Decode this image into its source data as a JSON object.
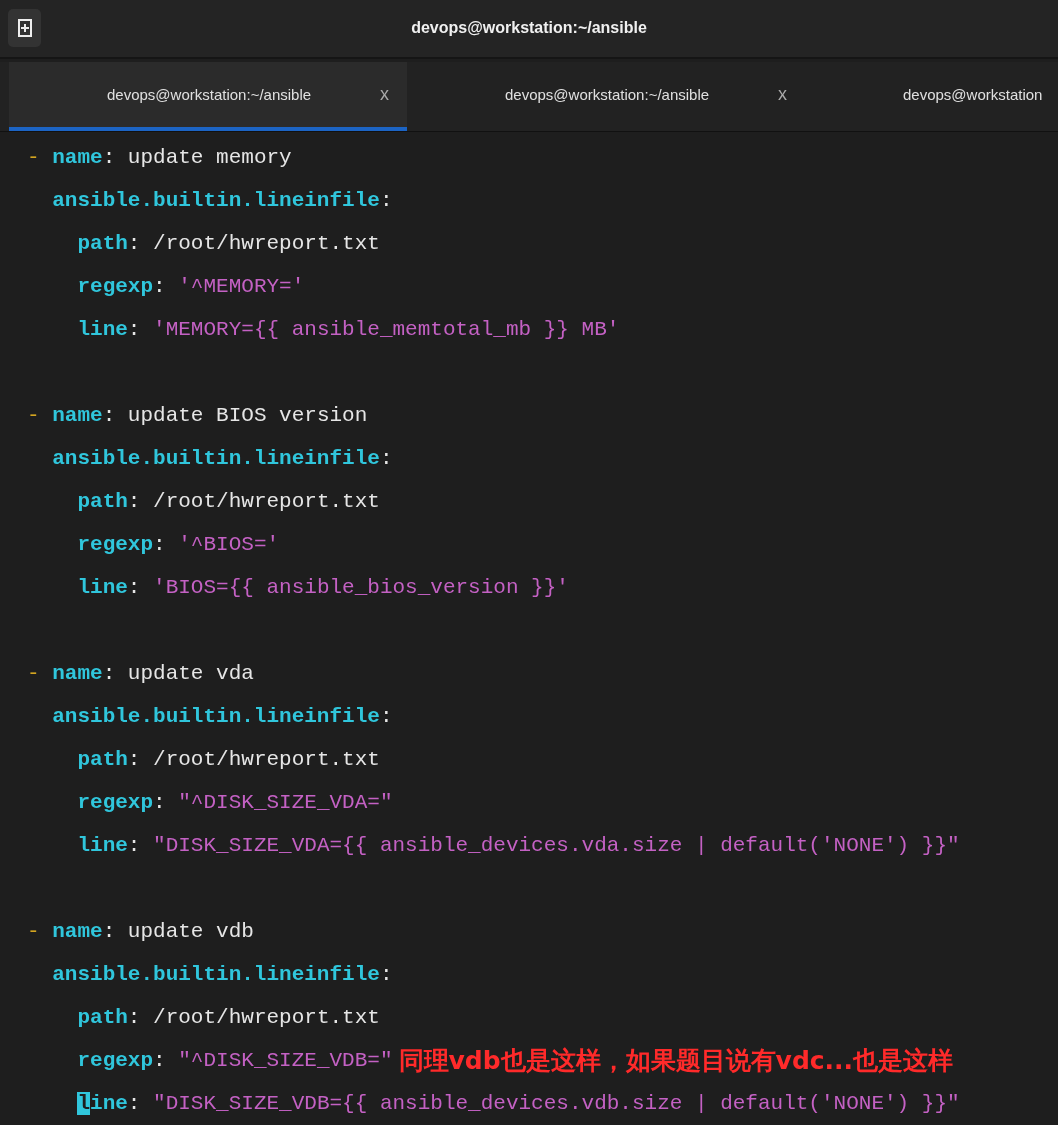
{
  "window": {
    "title": "devops@workstation:~/ansible"
  },
  "tabs": [
    {
      "label": "devops@workstation:~/ansible",
      "close": "x",
      "selected": true
    },
    {
      "label": "devops@workstation:~/ansible",
      "close": "x",
      "selected": false
    },
    {
      "label": "devops@workstation",
      "selected": false
    }
  ],
  "tasks": [
    {
      "dash": "-",
      "key": "name",
      "sep": ":",
      "value": "update memory",
      "module": "ansible.builtin.lineinfile",
      "module_sep": ":",
      "params": [
        {
          "key": "path",
          "sep": ":",
          "value": "/root/hwreport.txt",
          "kind": "plain"
        },
        {
          "key": "regexp",
          "sep": ":",
          "value": "'^MEMORY='",
          "kind": "string"
        },
        {
          "key": "line",
          "sep": ":",
          "value": "'MEMORY={{ ansible_memtotal_mb }} MB'",
          "kind": "string"
        }
      ]
    },
    {
      "dash": "-",
      "key": "name",
      "sep": ":",
      "value": "update BIOS version",
      "module": "ansible.builtin.lineinfile",
      "module_sep": ":",
      "params": [
        {
          "key": "path",
          "sep": ":",
          "value": "/root/hwreport.txt",
          "kind": "plain"
        },
        {
          "key": "regexp",
          "sep": ":",
          "value": "'^BIOS='",
          "kind": "string"
        },
        {
          "key": "line",
          "sep": ":",
          "value": "'BIOS={{ ansible_bios_version }}'",
          "kind": "string"
        }
      ]
    },
    {
      "dash": "-",
      "key": "name",
      "sep": ":",
      "value": "update vda",
      "module": "ansible.builtin.lineinfile",
      "module_sep": ":",
      "params": [
        {
          "key": "path",
          "sep": ":",
          "value": "/root/hwreport.txt",
          "kind": "plain"
        },
        {
          "key": "regexp",
          "sep": ":",
          "value": "\"^DISK_SIZE_VDA=\"",
          "kind": "string"
        },
        {
          "key": "line",
          "sep": ":",
          "value": "\"DISK_SIZE_VDA={{ ansible_devices.vda.size | default('NONE') }}\"",
          "kind": "string"
        }
      ]
    },
    {
      "dash": "-",
      "key": "name",
      "sep": ":",
      "value": "update vdb",
      "module": "ansible.builtin.lineinfile",
      "module_sep": ":",
      "params": [
        {
          "key": "path",
          "sep": ":",
          "value": "/root/hwreport.txt",
          "kind": "plain"
        },
        {
          "key": "regexp",
          "sep": ":",
          "value": "\"^DISK_SIZE_VDB=\"",
          "kind": "string",
          "annotation": "同理vdb也是这样，如果题目说有vdc...也是这样"
        },
        {
          "key": "line",
          "sep": ":",
          "value": "\"DISK_SIZE_VDB={{ ansible_devices.vdb.size | default('NONE') }}\"",
          "kind": "string",
          "cursor": true
        }
      ]
    }
  ]
}
